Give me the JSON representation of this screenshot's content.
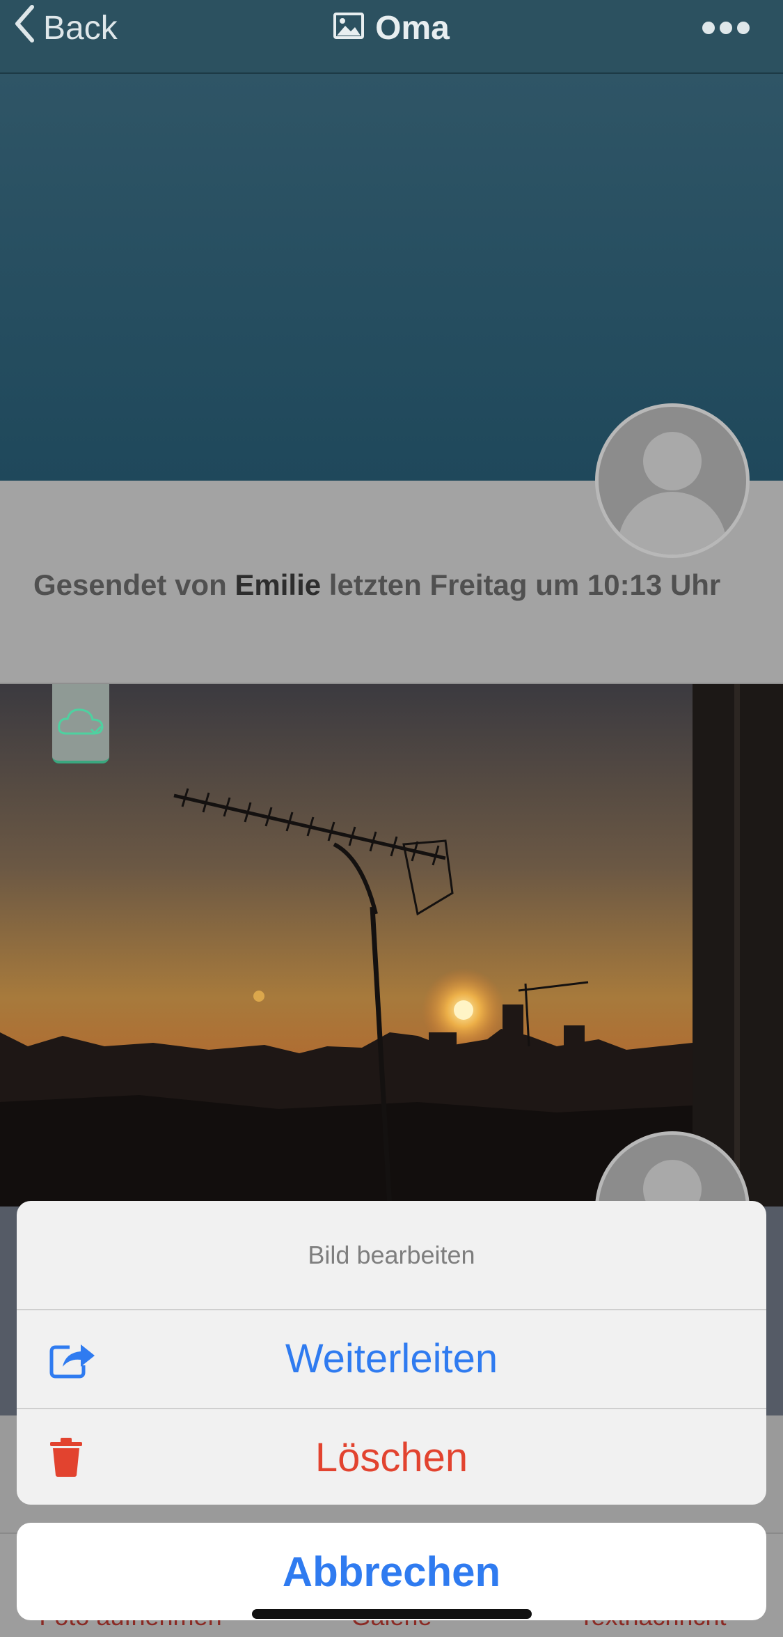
{
  "nav": {
    "back_label": "Back",
    "title": "Oma",
    "back_icon": "chevron-left-icon",
    "title_icon": "image-icon",
    "more_icon": "ellipsis-icon"
  },
  "messages": [
    {
      "caption_prefix": "Gesendet von ",
      "sender": "Emilie",
      "caption_suffix": " letzten Freitag um 10:13 Uhr",
      "image": "blank-teal-image"
    },
    {
      "image": "sunset-antenna-photo",
      "status_icon": "cloud-check-icon"
    }
  ],
  "tabs": [
    {
      "label": "Foto aufnehmen"
    },
    {
      "label": "Galerie"
    },
    {
      "label": "Textnachricht"
    }
  ],
  "action_sheet": {
    "title": "Bild bearbeiten",
    "actions": [
      {
        "label": "Weiterleiten",
        "icon": "share-icon",
        "color": "#2f7bf0"
      },
      {
        "label": "Löschen",
        "icon": "trash-icon",
        "color": "#e2432f"
      }
    ],
    "cancel_label": "Abbrechen"
  },
  "colors": {
    "navbar": "#2c5160",
    "accent_blue": "#2f7bf0",
    "destructive_red": "#e2432f",
    "upload_green": "#3aa77f"
  }
}
